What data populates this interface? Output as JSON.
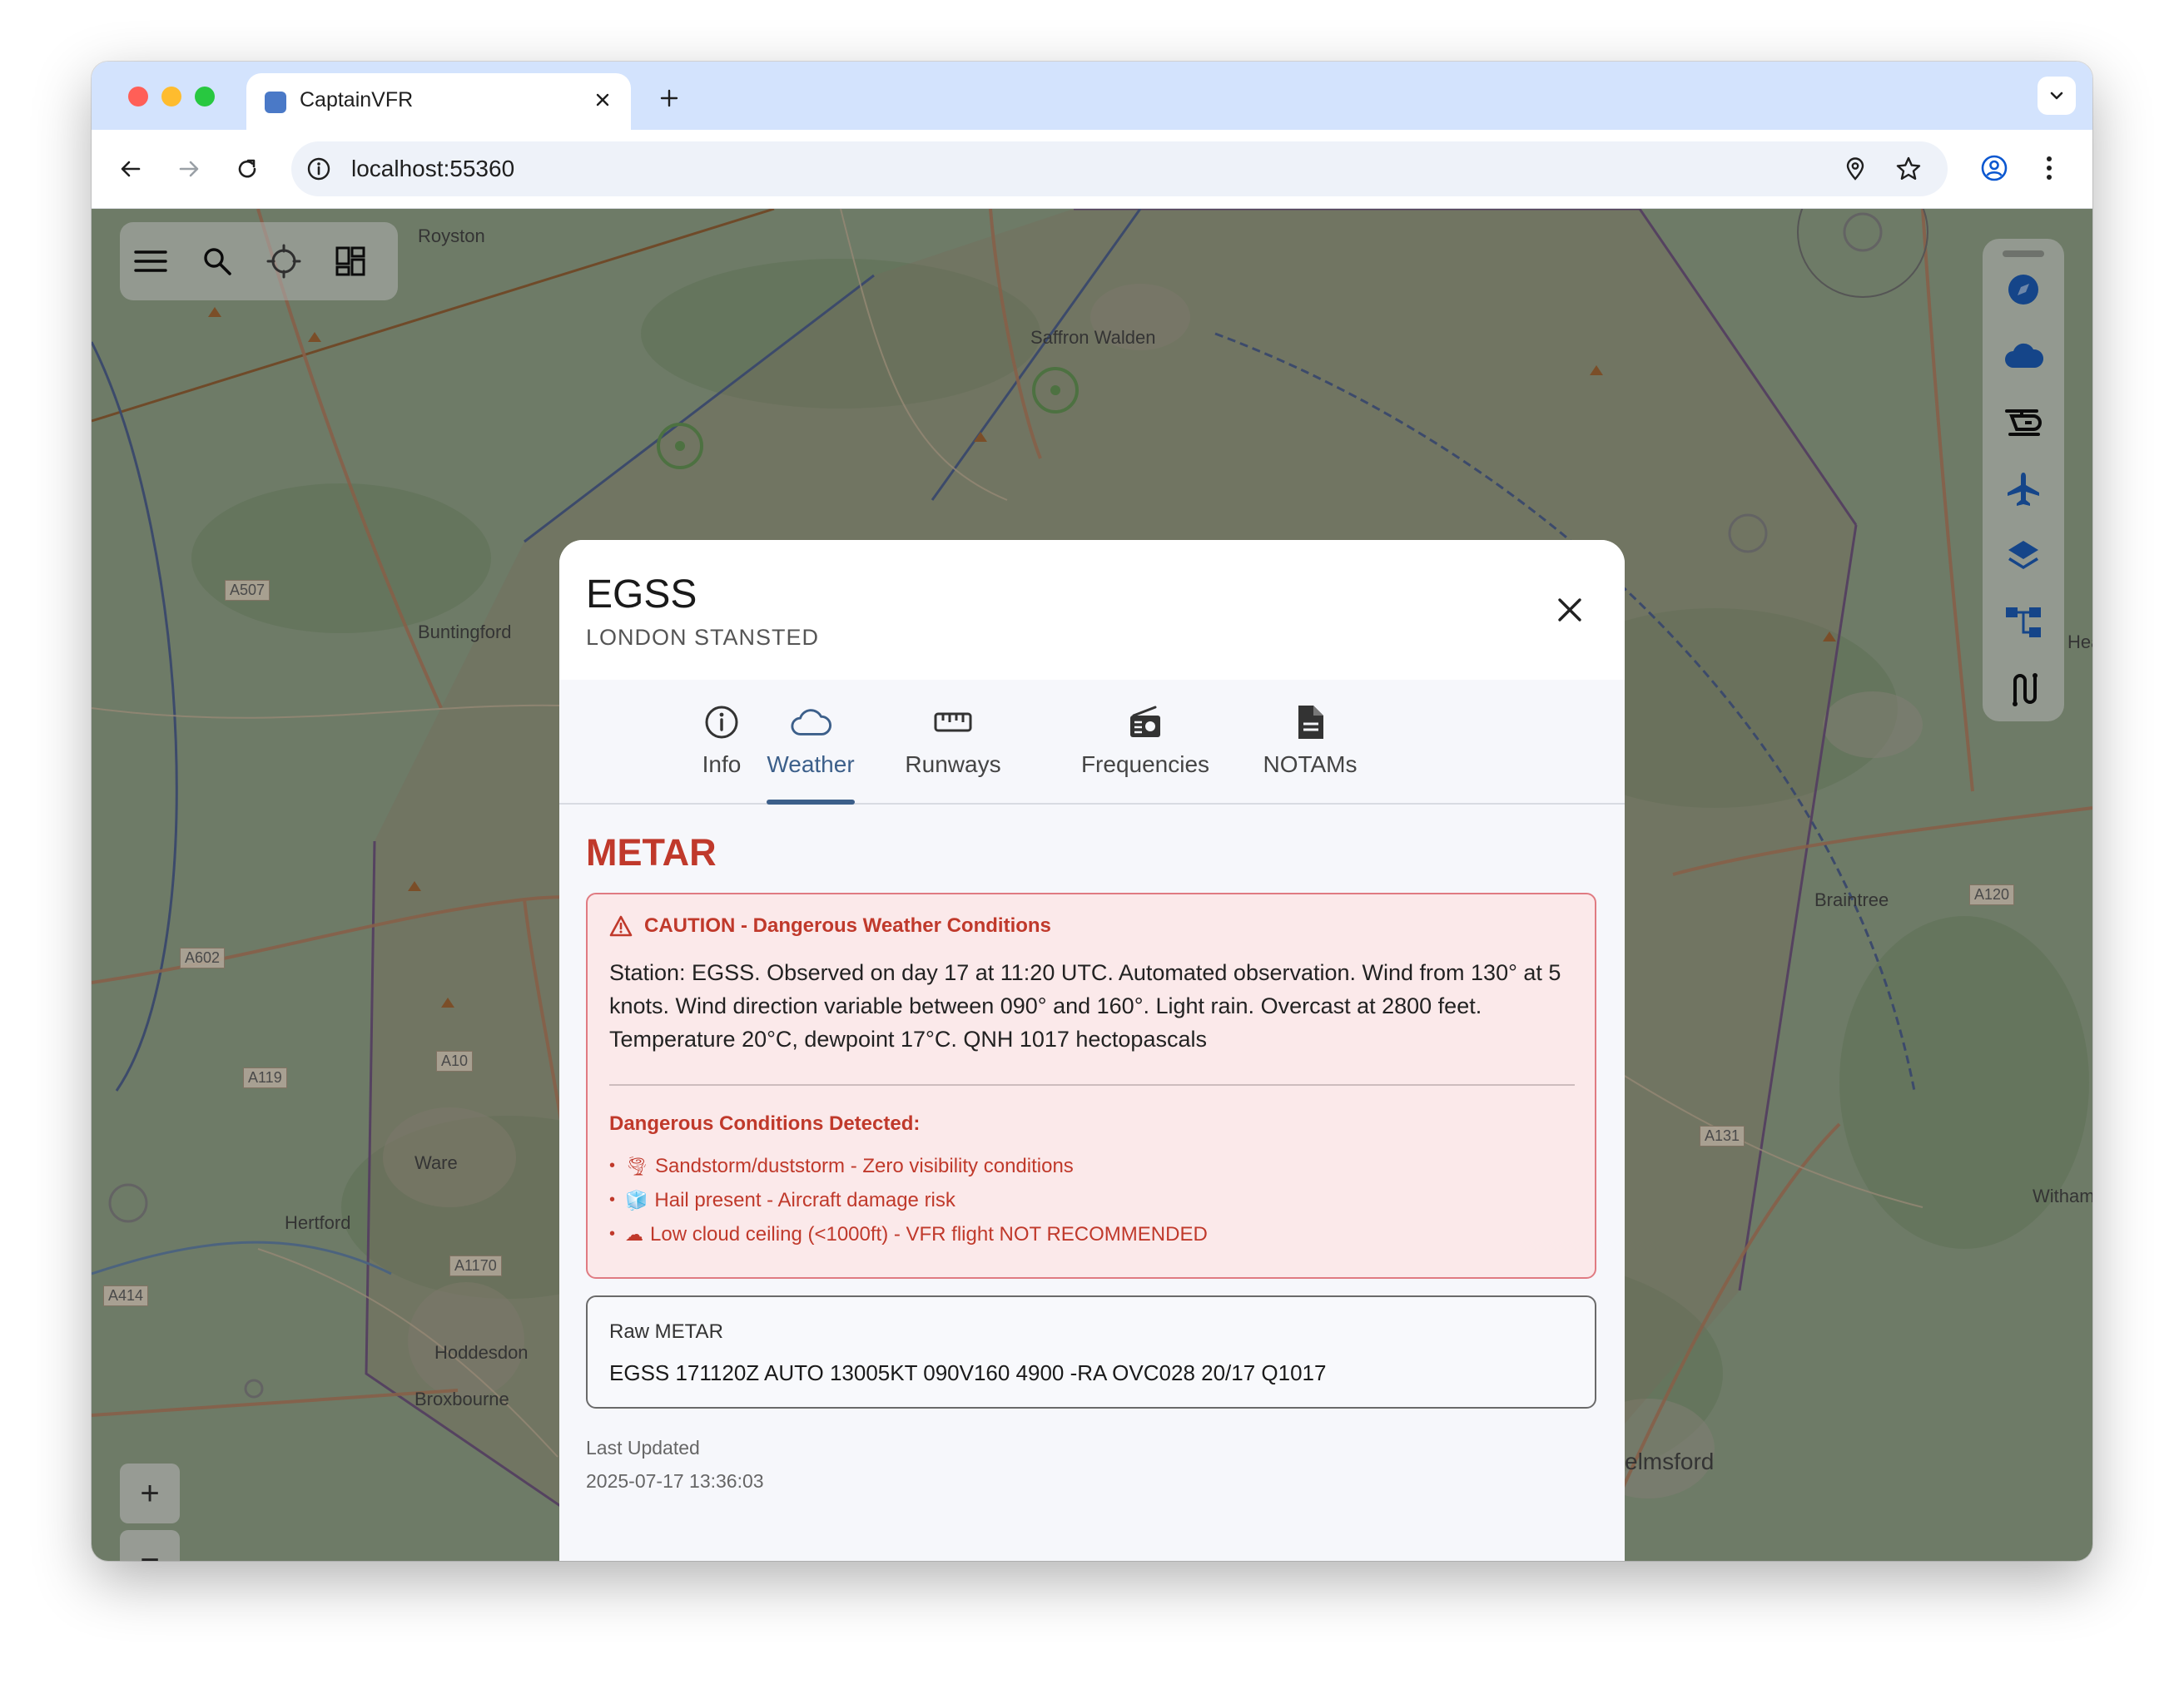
{
  "browser": {
    "tab_title": "CaptainVFR",
    "url": "localhost:55360",
    "colors": {
      "close": "#ff5f57",
      "minimize": "#febc2e",
      "maximize": "#28c840"
    }
  },
  "map": {
    "places": [
      "Royston",
      "Saffron Walden",
      "Buntingford",
      "Braintree",
      "Ware",
      "Hertford",
      "Hoddesdon",
      "Broxbourne",
      "elmsford",
      "Witham",
      "Hea"
    ],
    "roads": [
      "A507",
      "A602",
      "A119",
      "A10",
      "A1170",
      "A414",
      "A120",
      "A131"
    ],
    "controls": {
      "zoom_in": "+",
      "zoom_out": "−"
    }
  },
  "airport": {
    "icao": "EGSS",
    "name": "LONDON STANSTED"
  },
  "tabs": [
    {
      "label": "Info",
      "icon": "info-icon"
    },
    {
      "label": "Weather",
      "icon": "cloud-icon",
      "active": true
    },
    {
      "label": "Runways",
      "icon": "ruler-icon"
    },
    {
      "label": "Frequencies",
      "icon": "radio-icon"
    },
    {
      "label": "NOTAMs",
      "icon": "document-icon"
    }
  ],
  "metar": {
    "heading": "METAR",
    "caution_title": "CAUTION - Dangerous Weather Conditions",
    "decoded": "Station: EGSS. Observed on day 17 at 11:20 UTC. Automated observation. Wind from 130° at 5 knots. Wind direction variable between 090° and 160°. Light rain. Overcast at 2800 feet. Temperature 20°C, dewpoint 17°C. QNH 1017 hectopascals",
    "danger_heading": "Dangerous Conditions Detected:",
    "dangers": [
      {
        "emoji": "🌪",
        "text": "Sandstorm/duststorm - Zero visibility conditions"
      },
      {
        "emoji": "🧊",
        "text": "Hail present - Aircraft damage risk"
      },
      {
        "emoji": "☁",
        "text": "Low cloud ceiling (<1000ft) - VFR flight NOT RECOMMENDED"
      }
    ],
    "raw_label": "Raw METAR",
    "raw": "EGSS 171120Z AUTO 13005KT 090V160 4900 -RA OVC028 20/17 Q1017",
    "last_updated_label": "Last Updated",
    "last_updated": "2025-07-17 13:36:03"
  },
  "theme": {
    "accent": "#3c5f8a",
    "danger": "#c0392b",
    "danger_bg": "#fbe9ea"
  }
}
